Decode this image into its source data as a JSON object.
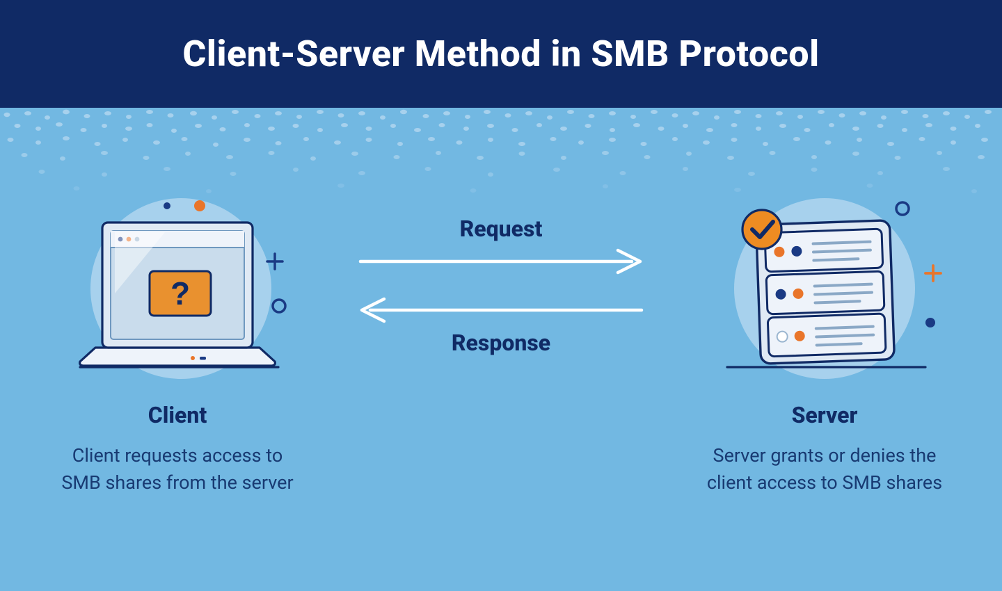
{
  "header": {
    "title": "Client-Server Method in SMB Protocol"
  },
  "left": {
    "title": "Client",
    "description": "Client requests access to SMB shares from the server"
  },
  "right": {
    "title": "Server",
    "description": "Server grants or denies the client access to SMB shares"
  },
  "arrows": {
    "request": "Request",
    "response": "Response"
  },
  "colors": {
    "header_bg": "#102a65",
    "page_bg": "#72b8e2",
    "text_dark": "#102a65",
    "accent_orange": "#e9752a",
    "accent_navy": "#1a3a84",
    "light_circle": "#a7d1ed",
    "white": "#ffffff"
  }
}
